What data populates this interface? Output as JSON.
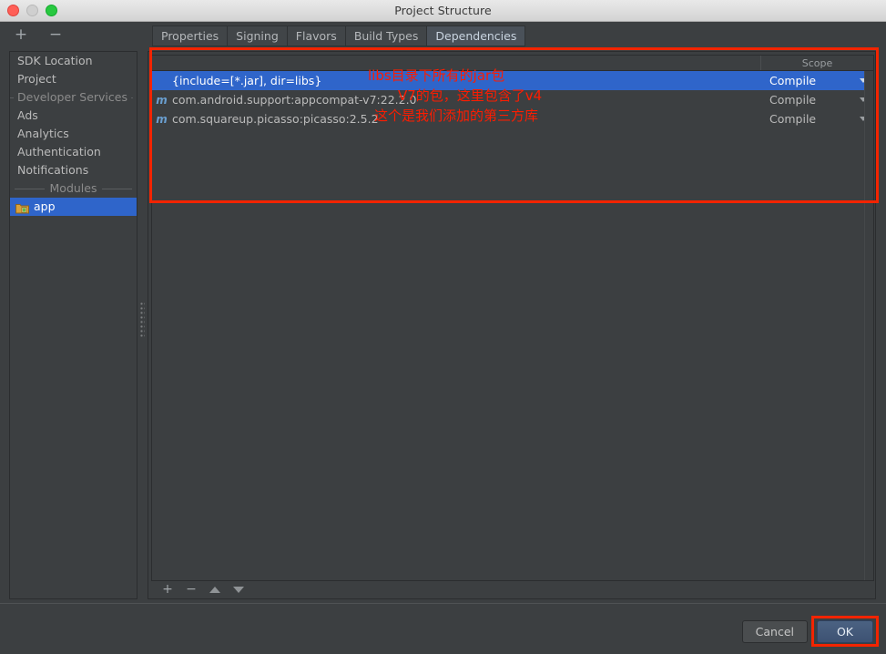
{
  "window": {
    "title": "Project Structure",
    "traffic_lights": [
      "close-red",
      "minimize-gray",
      "zoom-green"
    ]
  },
  "toolbar": {
    "add_label": "+",
    "remove_label": "−"
  },
  "tabs": [
    {
      "label": "Properties",
      "active": false
    },
    {
      "label": "Signing",
      "active": false
    },
    {
      "label": "Flavors",
      "active": false
    },
    {
      "label": "Build Types",
      "active": false
    },
    {
      "label": "Dependencies",
      "active": true
    }
  ],
  "sidebar": {
    "items": [
      {
        "label": "SDK Location",
        "type": "item"
      },
      {
        "label": "Project",
        "type": "item"
      },
      {
        "label": "Developer Services",
        "type": "separator"
      },
      {
        "label": "Ads",
        "type": "item"
      },
      {
        "label": "Analytics",
        "type": "item"
      },
      {
        "label": "Authentication",
        "type": "item"
      },
      {
        "label": "Notifications",
        "type": "item"
      },
      {
        "label": "Modules",
        "type": "separator"
      },
      {
        "label": "app",
        "type": "item",
        "selected": true,
        "icon": "android-module-icon"
      }
    ],
    "sdk_location": "SDK Location",
    "project": "Project",
    "developer_services": "Developer Services",
    "ads": "Ads",
    "analytics": "Analytics",
    "authentication": "Authentication",
    "notifications": "Notifications",
    "modules": "Modules",
    "app": "app"
  },
  "dependencies_table": {
    "columns": [
      {
        "key": "name",
        "label": ""
      },
      {
        "key": "scope",
        "label": "Scope"
      }
    ],
    "rows": [
      {
        "name": "{include=[*.jar], dir=libs}",
        "scope": "Compile",
        "icon": "",
        "selected": true
      },
      {
        "name": "com.android.support:appcompat-v7:22.2.0",
        "scope": "Compile",
        "icon": "maven-m-icon",
        "selected": false
      },
      {
        "name": "com.squareup.picasso:picasso:2.5.2",
        "scope": "Compile",
        "icon": "maven-m-icon",
        "selected": false
      }
    ]
  },
  "table_toolbar": {
    "add_label": "+",
    "remove_label": "−",
    "move_up_label": "move-up",
    "move_down_label": "move-down"
  },
  "footer": {
    "cancel_label": "Cancel",
    "ok_label": "OK"
  },
  "annotations": {
    "color": "#fd1c00",
    "texts": [
      "libs目录下所有的jar包",
      "V7的包，这里包含了v4",
      "这个是我们添加的第三方库"
    ],
    "line1": "libs目录下所有的jar包",
    "line2": "V7的包，这里包含了v4",
    "line3": "这个是我们添加的第三方库",
    "boxes": [
      "dependencies-table-highlight",
      "ok-button-highlight"
    ]
  },
  "colors": {
    "selection_blue": "#2f65ca",
    "panel_bg": "#3c3f41",
    "annotation_red": "#fd1c00",
    "ok_button_blue": "#42597a"
  }
}
